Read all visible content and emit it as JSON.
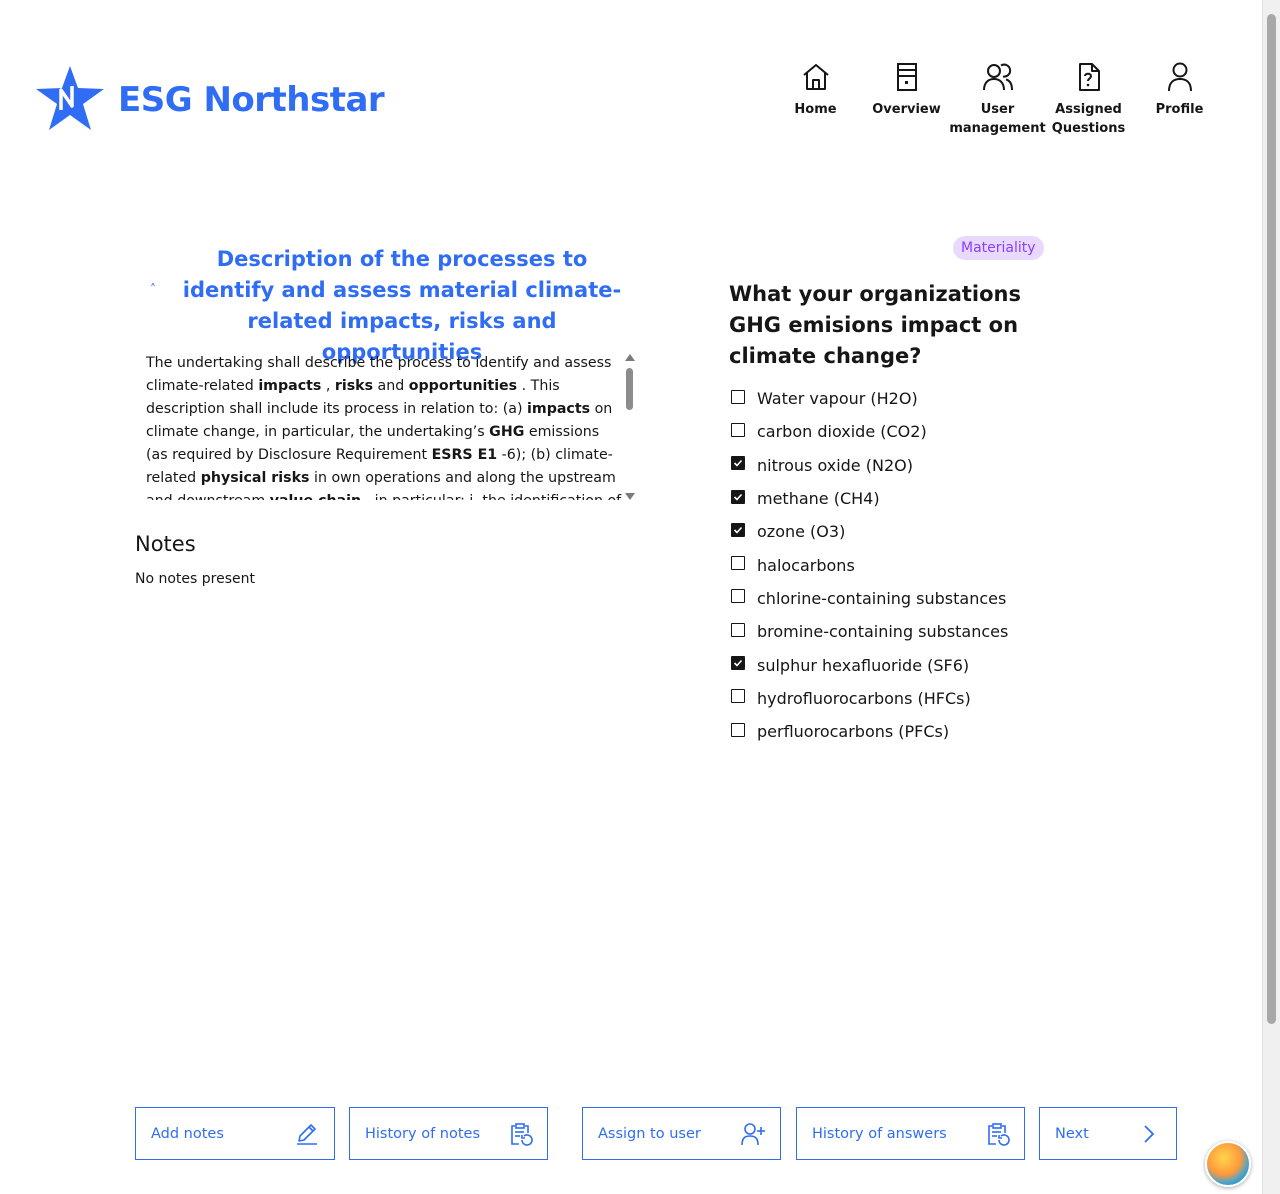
{
  "brand": {
    "name": "ESG Northstar",
    "color": "#2f6df5"
  },
  "nav": [
    {
      "key": "home",
      "label": "Home",
      "icon": "home-icon"
    },
    {
      "key": "overview",
      "label": "Overview",
      "icon": "building-icon"
    },
    {
      "key": "user_management",
      "label": "User management",
      "icon": "users-icon"
    },
    {
      "key": "assigned_questions",
      "label": "Assigned Questions",
      "icon": "document-question-icon"
    },
    {
      "key": "profile",
      "label": "Profile",
      "icon": "user-icon"
    }
  ],
  "description": {
    "title": "Description of the processes to identify and assess material climate-related impacts, risks and opportunities",
    "body_html": "The undertaking shall describe the process to identify and assess climate-related <b>impacts</b> , <b>risks</b> and <b>opportunities</b> . This description shall include its process in relation to: (a) <b>impacts</b> on climate change, in particular, the undertaking’s <b>GHG</b> emissions (as required by Disclosure Requirement <b>ESRS E1</b> -6); (b) climate-related <b>physical risks</b> in own operations and along the upstream and downstream <b>value chain</b> , in particular: i. the identification of climate-related"
  },
  "notes": {
    "title": "Notes",
    "empty_text": "No notes present"
  },
  "question": {
    "tag": "Materiality",
    "text": "What your organizations GHG emisions impact on climate change?",
    "options": [
      {
        "label": "Water vapour (H2O)",
        "checked": false
      },
      {
        "label": "carbon dioxide (CO2)",
        "checked": false
      },
      {
        "label": "nitrous oxide (N2O)",
        "checked": true
      },
      {
        "label": "methane (CH4)",
        "checked": true
      },
      {
        "label": "ozone (O3)",
        "checked": true
      },
      {
        "label": "halocarbons",
        "checked": false
      },
      {
        "label": "chlorine-containing substances",
        "checked": false
      },
      {
        "label": "bromine-containing substances",
        "checked": false
      },
      {
        "label": "sulphur hexafluoride (SF6)",
        "checked": true
      },
      {
        "label": "hydrofluorocarbons (HFCs)",
        "checked": false
      },
      {
        "label": "perfluorocarbons (PFCs)",
        "checked": false
      }
    ]
  },
  "actions": {
    "add_notes": "Add notes",
    "history_of_notes": "History of notes",
    "assign_to_user": "Assign to user",
    "history_of_answers": "History of answers",
    "next": "Next"
  },
  "colors": {
    "tag_bg": "#e8daff",
    "tag_text": "#8a3ffc",
    "checkbox": "#161616"
  }
}
